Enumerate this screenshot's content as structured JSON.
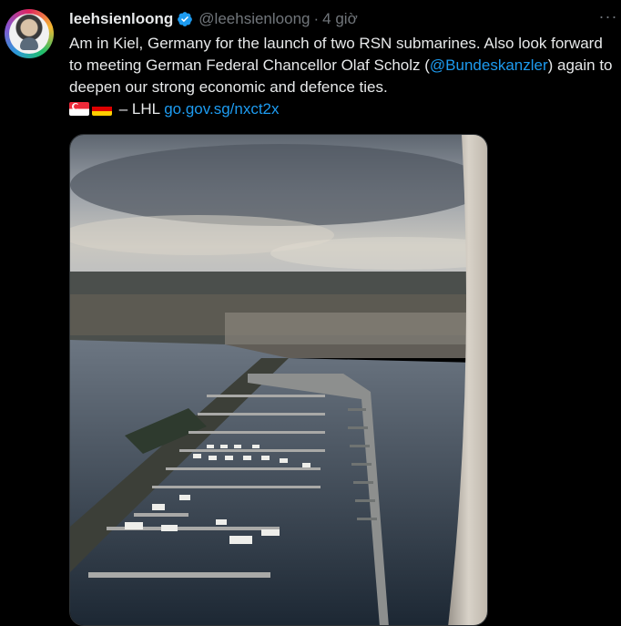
{
  "tweet": {
    "display_name": "leehsienloong",
    "handle": "@leehsienloong",
    "separator": "·",
    "time": "4 giờ",
    "more_label": "···",
    "text_part1": "Am in Kiel, Germany for the launch of two RSN submarines. Also look forward to meeting German Federal Chancellor Olaf Scholz (",
    "mention": "@Bundeskanzler",
    "text_part2": ") again to deepen our strong economic and defence ties.",
    "signature": "– LHL",
    "link": "go.gov.sg/nxct2x",
    "flags": [
      "singapore-flag-icon",
      "germany-flag-icon"
    ]
  },
  "colors": {
    "background": "#000000",
    "text": "#e7e9ea",
    "secondary": "#71767b",
    "accent": "#1d9bf0"
  },
  "media": {
    "kind": "aerial photo of marina in Kiel from airplane window"
  }
}
